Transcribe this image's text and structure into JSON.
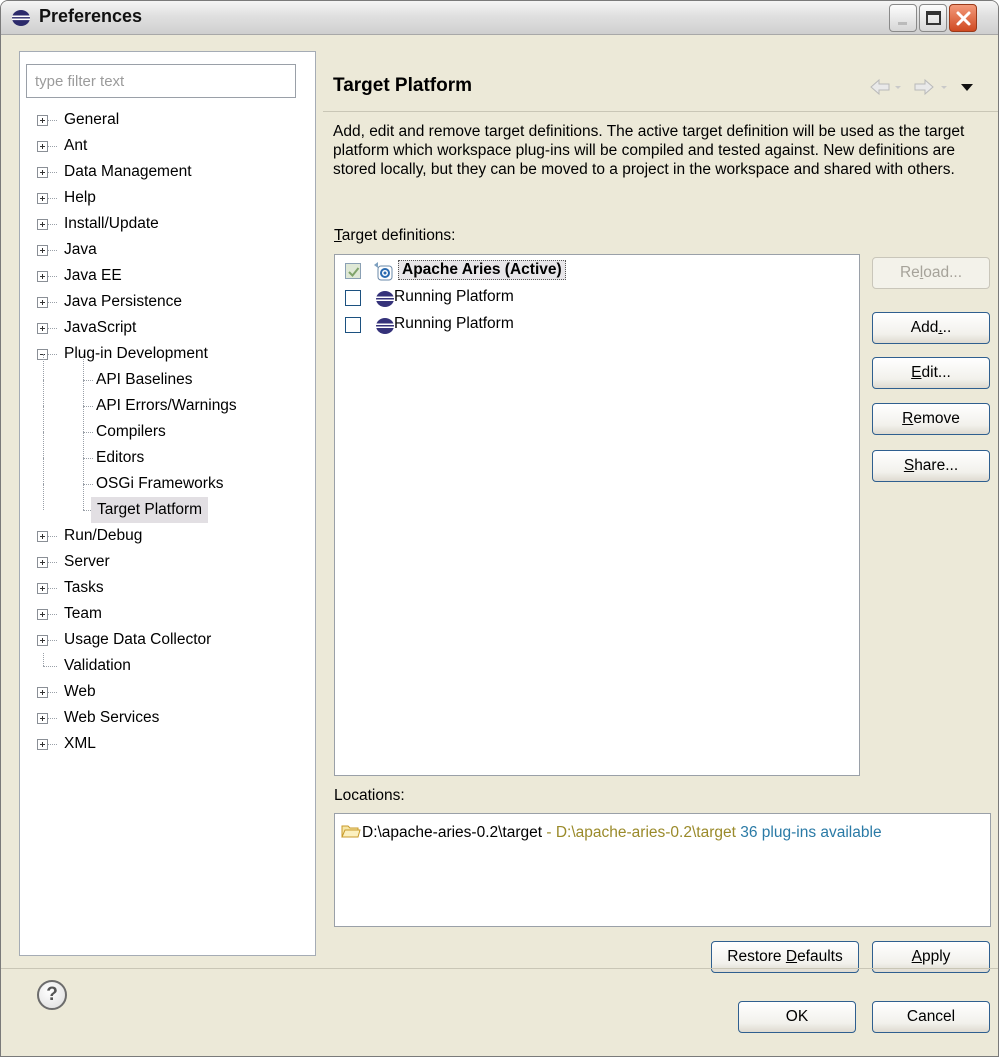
{
  "window": {
    "title": "Preferences",
    "controls": [
      "minimize-icon",
      "maximize-icon",
      "close-icon"
    ]
  },
  "filter": {
    "placeholder": "type filter text",
    "value": ""
  },
  "tree": {
    "items": [
      {
        "label": "General",
        "type": "collapsed"
      },
      {
        "label": "Ant",
        "type": "collapsed"
      },
      {
        "label": "Data Management",
        "type": "collapsed"
      },
      {
        "label": "Help",
        "type": "collapsed"
      },
      {
        "label": "Install/Update",
        "type": "collapsed"
      },
      {
        "label": "Java",
        "type": "collapsed"
      },
      {
        "label": "Java EE",
        "type": "collapsed"
      },
      {
        "label": "Java Persistence",
        "type": "collapsed"
      },
      {
        "label": "JavaScript",
        "type": "collapsed"
      },
      {
        "label": "Plug-in Development",
        "type": "expanded"
      },
      {
        "label": "API Baselines",
        "type": "child"
      },
      {
        "label": "API Errors/Warnings",
        "type": "child"
      },
      {
        "label": "Compilers",
        "type": "child"
      },
      {
        "label": "Editors",
        "type": "child"
      },
      {
        "label": "OSGi Frameworks",
        "type": "child"
      },
      {
        "label": "Target Platform",
        "type": "child",
        "selected": true
      },
      {
        "label": "Run/Debug",
        "type": "collapsed"
      },
      {
        "label": "Server",
        "type": "collapsed"
      },
      {
        "label": "Tasks",
        "type": "collapsed"
      },
      {
        "label": "Team",
        "type": "collapsed"
      },
      {
        "label": "Usage Data Collector",
        "type": "collapsed"
      },
      {
        "label": "Validation",
        "type": "leaf"
      },
      {
        "label": "Web",
        "type": "collapsed"
      },
      {
        "label": "Web Services",
        "type": "collapsed"
      },
      {
        "label": "XML",
        "type": "collapsed"
      }
    ]
  },
  "page": {
    "title": "Target Platform",
    "description": "Add, edit and remove target definitions.  The active target definition will be used as the target platform which workspace plug-ins will be compiled and tested against. New definitions are stored locally, but they can be moved to a project in the workspace and shared with others.",
    "targets_label_mnemonic": "T",
    "targets_label_rest": "arget definitions:",
    "targets": [
      {
        "label": "Apache Aries (Active)",
        "checked": true,
        "active": true,
        "icon": "target-definition-icon"
      },
      {
        "label": "Running Platform",
        "checked": false,
        "active": false,
        "icon": "eclipse-icon"
      },
      {
        "label": "Running Platform",
        "checked": false,
        "active": false,
        "icon": "eclipse-icon"
      }
    ],
    "buttons": {
      "reload": {
        "pre": "Re",
        "mn": "l",
        "post": "oad..."
      },
      "add": {
        "pre": "Add",
        "mn": ".",
        "post": ".."
      },
      "edit": {
        "pre": "",
        "mn": "E",
        "post": "dit..."
      },
      "remove": {
        "pre": "",
        "mn": "R",
        "post": "emove"
      },
      "share": {
        "pre": "",
        "mn": "S",
        "post": "hare..."
      }
    },
    "locations_label": "Locations:",
    "location": {
      "path": "D:\\apache-aries-0.2\\target",
      "separator": " - ",
      "detail": "D:\\apache-aries-0.2\\target",
      "count": " 36 plug-ins available"
    },
    "restore_defaults": {
      "pre": "Restore ",
      "mn": "D",
      "post": "efaults"
    },
    "apply": {
      "pre": "",
      "mn": "A",
      "post": "pply"
    }
  },
  "dialog": {
    "ok": "OK",
    "cancel": "Cancel",
    "help": "?"
  }
}
